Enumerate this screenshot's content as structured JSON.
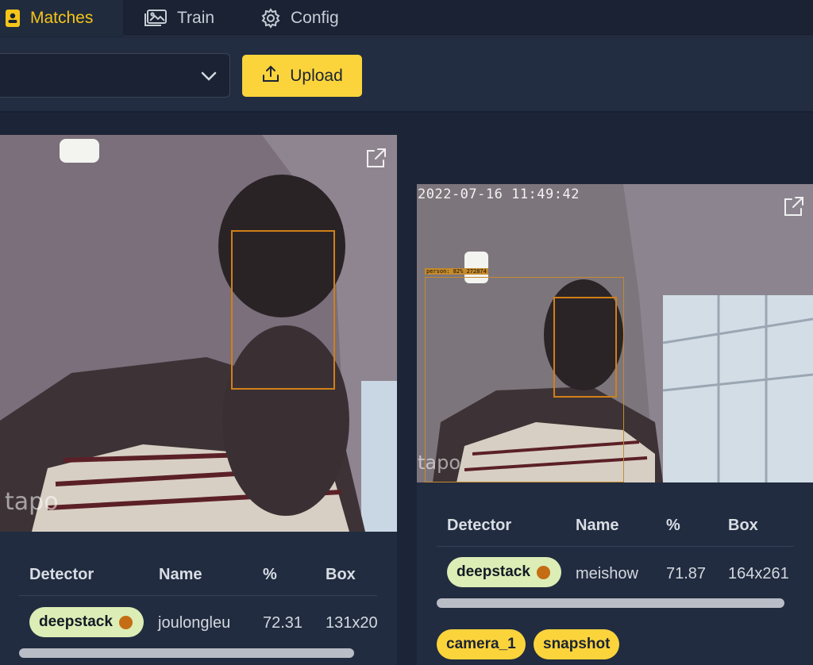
{
  "nav": {
    "tabs": [
      {
        "label": "Matches",
        "icon": "user-badge-icon",
        "active": true
      },
      {
        "label": "Train",
        "icon": "images-icon",
        "active": false
      },
      {
        "label": "Config",
        "icon": "gear-icon",
        "active": false
      }
    ]
  },
  "toolbar": {
    "select_value": "",
    "upload_label": "Upload"
  },
  "colors": {
    "accent": "#fbd43c",
    "active_tab_text": "#f5c518",
    "detector_pill": "#dcedb6",
    "detector_dot": "#c46d14",
    "face_box": "#d08018"
  },
  "cards": [
    {
      "image_watermark": "tapo",
      "table": {
        "headers": [
          "Detector",
          "Name",
          "%",
          "Box"
        ],
        "rows": [
          {
            "detector": "deepstack",
            "name": "joulongleu",
            "percent": "72.31",
            "box": "131x20"
          }
        ]
      }
    },
    {
      "image_timestamp": "2022-07-16 11:49:42",
      "image_person_label": "person: 82% 272874",
      "image_watermark": "tapo",
      "table": {
        "headers": [
          "Detector",
          "Name",
          "%",
          "Box"
        ],
        "rows": [
          {
            "detector": "deepstack",
            "name": "meishow",
            "percent": "71.87",
            "box": "164x261"
          }
        ]
      },
      "tags": [
        "camera_1",
        "snapshot"
      ]
    }
  ]
}
